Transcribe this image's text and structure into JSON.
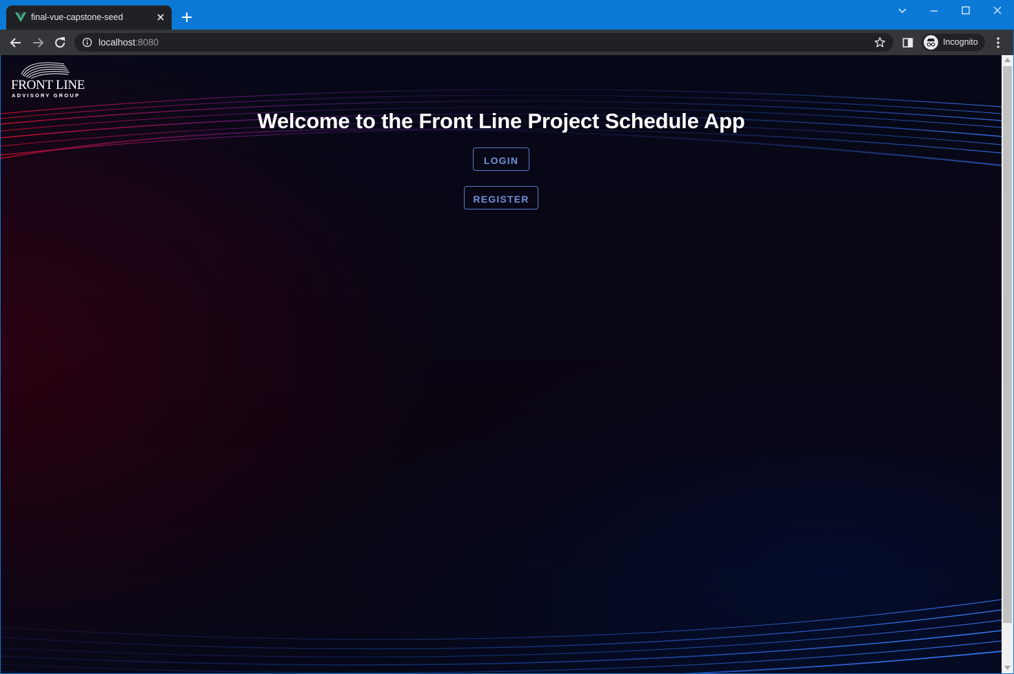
{
  "browser": {
    "tab_title": "final-vue-capstone-seed",
    "url_host": "localhost",
    "url_port": ":8080",
    "profile_label": "Incognito",
    "accent_color": "#0c79d6"
  },
  "icons": {
    "favicon": "vue-logo-icon",
    "close": "close-icon",
    "new_tab": "plus-icon",
    "back": "back-arrow-icon",
    "forward": "forward-arrow-icon",
    "reload": "reload-icon",
    "info": "info-icon",
    "bookmark": "star-icon",
    "side_panel": "side-panel-icon",
    "incognito": "incognito-icon",
    "menu": "kebab-menu-icon"
  },
  "page": {
    "logo_main": "FRONT LINE",
    "logo_sub": "ADVISORY GROUP",
    "title": "Welcome to the Front Line Project Schedule App",
    "login_label": "LOGIN",
    "register_label": "REGISTER",
    "button_color": "#6f93d6"
  }
}
